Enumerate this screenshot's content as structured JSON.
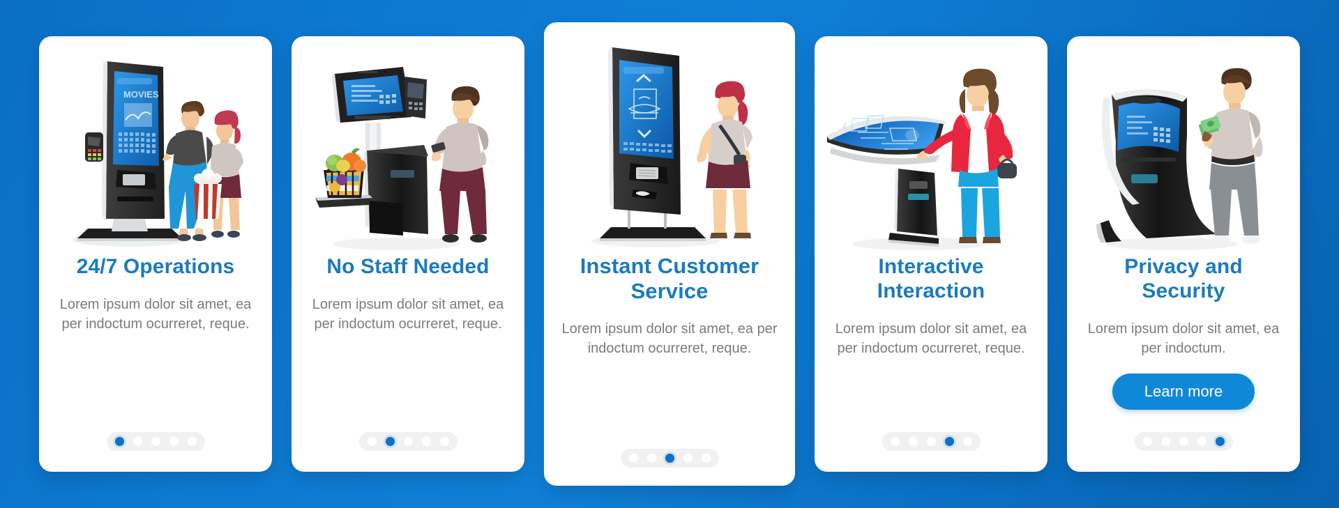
{
  "theme": {
    "background_gradient_from": "#0a6fc4",
    "background_gradient_to": "#0862b0",
    "card_background": "#ffffff",
    "title_color": "#1b7bbd",
    "body_color": "#7b7b7b",
    "accent_color": "#1088d8",
    "dot_active_color": "#0a72c8",
    "dot_inactive_color": "#ffffff",
    "dots_track_color": "#f1f1f1"
  },
  "screens": [
    {
      "id": "operations",
      "title": "24/7 Operations",
      "body": "Lorem ipsum dolor sit amet, ea per indoctum ocurreret, reque.",
      "illustration": "movie-ticket-kiosk-couple-popcorn",
      "kiosk_screen_label": "MOVIES",
      "dots_total": 5,
      "dots_active_index": 0,
      "has_button": false
    },
    {
      "id": "no-staff",
      "title": "No Staff Needed",
      "body": "Lorem ipsum dolor sit amet, ea per indoctum ocurreret, reque.",
      "illustration": "self-checkout-kiosk-grocery-basket-man-card",
      "kiosk_screen_label": "",
      "dots_total": 5,
      "dots_active_index": 1,
      "has_button": false
    },
    {
      "id": "customer-service",
      "title": "Instant Customer Service",
      "body": "Lorem ipsum dolor sit amet, ea per indoctum ocurreret, reque.",
      "illustration": "food-ordering-kiosk-woman",
      "kiosk_screen_label": "",
      "dots_total": 5,
      "dots_active_index": 2,
      "has_button": false
    },
    {
      "id": "interactive",
      "title": "Interactive Interaction",
      "body": "Lorem ipsum dolor sit amet, ea per indoctum ocurreret, reque.",
      "illustration": "interactive-touch-table-woman-red-coat",
      "kiosk_screen_label": "",
      "dots_total": 5,
      "dots_active_index": 3,
      "has_button": false
    },
    {
      "id": "privacy",
      "title": "Privacy and Security",
      "body": "Lorem ipsum dolor sit amet, ea per indoctum.",
      "illustration": "curved-kiosk-man-cash",
      "kiosk_screen_label": "",
      "dots_total": 5,
      "dots_active_index": 4,
      "has_button": true,
      "button_label": "Learn more"
    }
  ]
}
